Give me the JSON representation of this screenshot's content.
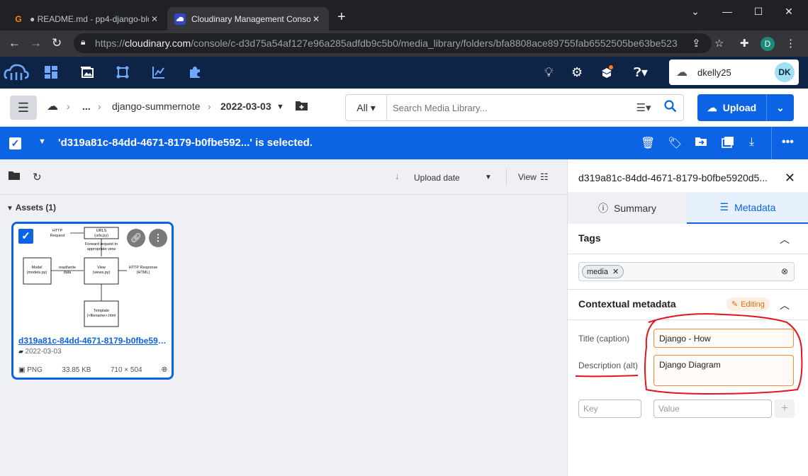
{
  "browser": {
    "tabs": [
      {
        "favicon": "G",
        "title": "● README.md - pp4-django-blo"
      },
      {
        "favicon": "cloudinary-icon",
        "title": "Cloudinary Management Console"
      }
    ],
    "url_prefix": "https://",
    "url_domain": "cloudinary.com",
    "url_path": "/console/c-d3d75a54af127e96a285adfdb9c5b0/media_library/folders/bfa8808ace89755fab6552505be63be523",
    "profile_initial": "D"
  },
  "account": {
    "username": "dkelly25",
    "initials": "DK"
  },
  "breadcrumb": {
    "ellipsis": "...",
    "folder": "django-summernote",
    "current": "2022-03-03"
  },
  "search": {
    "scope": "All",
    "placeholder": "Search Media Library..."
  },
  "upload": {
    "label": "Upload"
  },
  "selection": {
    "text": "'d319a81c-84dd-4671-8179-b0fbe592...' is selected."
  },
  "sort": {
    "label": "Upload date",
    "view_label": "View"
  },
  "assets": {
    "header": "Assets (1)",
    "items": [
      {
        "name": "d319a81c-84dd-4671-8179-b0fbe5920...",
        "folder": "2022-03-03",
        "format": "PNG",
        "size": "33.85 KB",
        "dimensions": "710 × 504",
        "diagram": {
          "http_request": [
            "HTTP",
            "Request"
          ],
          "urls": [
            "URLS",
            "(urls.py)"
          ],
          "forward": [
            "Forward request to",
            "appropriate view"
          ],
          "model": [
            "Model",
            "(models.py)"
          ],
          "readwrite": [
            "read/write",
            "data"
          ],
          "view": [
            "View",
            "(views.py)"
          ],
          "http_response": [
            "HTTP Response",
            "(HTML)"
          ],
          "template": [
            "Template",
            "(<filename>.html"
          ]
        }
      }
    ]
  },
  "details": {
    "title": "d319a81c-84dd-4671-8179-b0fbe5920d5...",
    "tabs": {
      "summary": "Summary",
      "metadata": "Metadata"
    },
    "tags_header": "Tags",
    "tags": [
      "media"
    ],
    "contextual_header": "Contextual metadata",
    "editing_badge": "Editing",
    "title_label": "Title (caption)",
    "title_value": "Django - How",
    "desc_label": "Description (alt)",
    "desc_value": "Django Diagram",
    "key_placeholder": "Key",
    "value_placeholder": "Value"
  },
  "colors": {
    "accent": "#0c63e4",
    "appbar": "#0d2447",
    "annotation": "#e5131d",
    "editing": "#d9711c"
  }
}
